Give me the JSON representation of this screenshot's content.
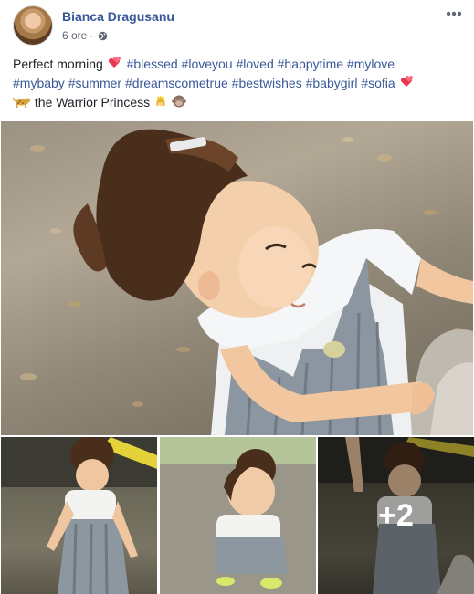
{
  "post": {
    "author_name": "Bianca Dragusanu",
    "timestamp": "6 ore",
    "privacy_icon": "globe-icon",
    "more_icon": "more-horizontal-icon",
    "caption": {
      "text_start": "Perfect morning",
      "hashtags_line1": [
        "#blessed",
        "#loveyou",
        "#loved",
        "#happytime",
        "#mylove"
      ],
      "hashtags_line2": [
        "#mybaby",
        "#summer",
        "#dreamscometrue",
        "#bestwishes",
        "#babygirl",
        "#sofia"
      ],
      "text_end": "the Warrior Princess"
    },
    "more_photos_label": "+2",
    "colors": {
      "link": "#385898",
      "text": "#1d2129",
      "meta": "#616770"
    }
  }
}
